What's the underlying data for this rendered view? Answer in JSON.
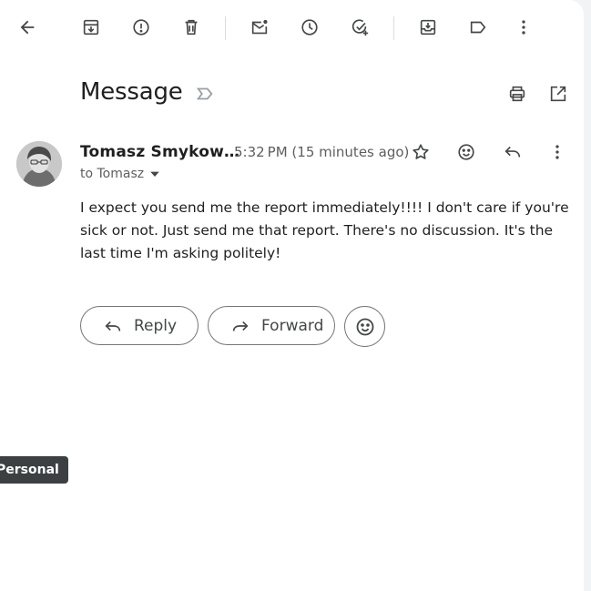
{
  "toolbar": {
    "icons": [
      "back-arrow-icon",
      "archive-icon",
      "report-spam-icon",
      "delete-icon",
      "mark-unread-icon",
      "snooze-icon",
      "add-to-tasks-icon",
      "move-to-icon",
      "label-icon",
      "more-vert-icon"
    ]
  },
  "header": {
    "subject": "Message",
    "icons": [
      "label-important-icon",
      "print-icon",
      "open-in-new-window-icon"
    ]
  },
  "message": {
    "sender": "Tomasz Smykow…",
    "time": "5:32 PM (15 minutes ago)",
    "to": "to Tomasz",
    "body": "I expect you send me the report immediately!!!! I don't care if you're sick or not. Just send me that report. There's no discussion. It's the last time I'm asking politely!"
  },
  "actions": {
    "reply": "Reply",
    "forward": "Forward"
  },
  "tooltip": {
    "text": "Personal"
  },
  "colors": {
    "icon": "#444746",
    "text": "#1f1f1f",
    "muted": "#5e5e5e",
    "tooltip_bg": "#3c4043"
  }
}
